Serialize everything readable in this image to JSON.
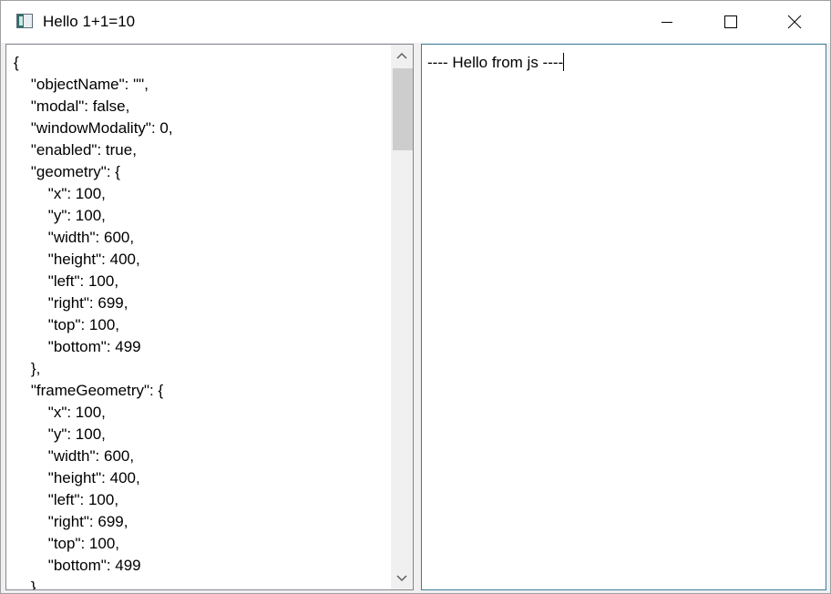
{
  "window": {
    "title": "Hello 1+1=10"
  },
  "icons": {
    "app": "app-window-icon",
    "minimize": "minimize-icon",
    "maximize": "maximize-icon",
    "close": "close-icon",
    "scroll_up": "chevron-up-icon",
    "scroll_down": "chevron-down-icon"
  },
  "left_panel": {
    "lines": [
      "{",
      "    \"objectName\": \"\",",
      "    \"modal\": false,",
      "    \"windowModality\": 0,",
      "    \"enabled\": true,",
      "    \"geometry\": {",
      "        \"x\": 100,",
      "        \"y\": 100,",
      "        \"width\": 600,",
      "        \"height\": 400,",
      "        \"left\": 100,",
      "        \"right\": 699,",
      "        \"top\": 100,",
      "        \"bottom\": 499",
      "    },",
      "    \"frameGeometry\": {",
      "        \"x\": 100,",
      "        \"y\": 100,",
      "        \"width\": 600,",
      "        \"height\": 400,",
      "        \"left\": 100,",
      "        \"right\": 699,",
      "        \"top\": 100,",
      "        \"bottom\": 499",
      "    },"
    ]
  },
  "right_panel": {
    "text": "---- Hello from js ----"
  }
}
